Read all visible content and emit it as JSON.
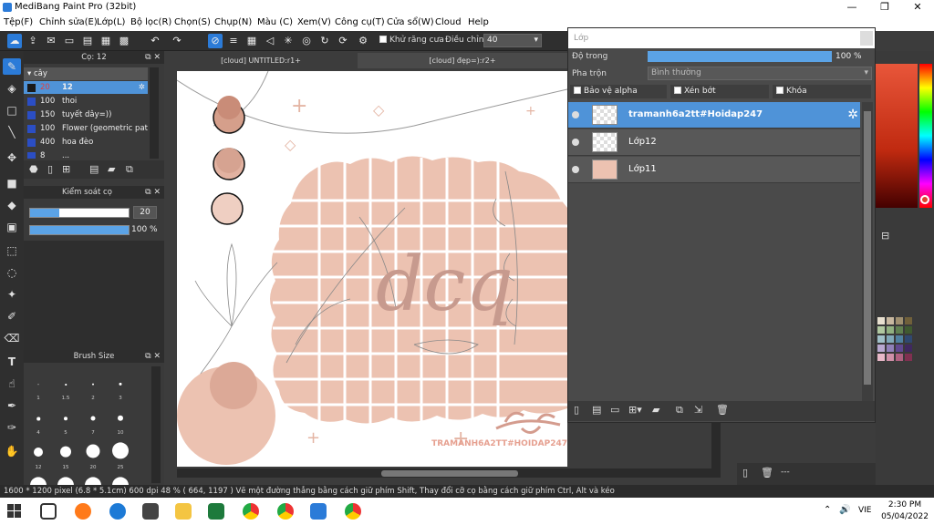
{
  "window": {
    "title": "MediBang Paint Pro (32bit)",
    "minimize": "—",
    "restore": "❐",
    "close": "✕"
  },
  "menu": [
    "Tệp(F)",
    "Chỉnh sửa(E)",
    "Lớp(L)",
    "Bộ lọc(R)",
    "Chọn(S)",
    "Chụp(N)",
    "Màu (C)",
    "Xem(V)",
    "Công cụ(T)",
    "Cửa sổ(W)",
    "Cloud",
    "Help"
  ],
  "toolbar": {
    "antialias_label": "Khử răng cưa",
    "adjust_label": "Điều chỉnh",
    "adjust_value": "40"
  },
  "brush_panel": {
    "title": "Cọ: 12",
    "category": "cây",
    "items": [
      {
        "size": "20",
        "name": "12"
      },
      {
        "size": "100",
        "name": "thoi"
      },
      {
        "size": "150",
        "name": "tuyết dây=))"
      },
      {
        "size": "100",
        "name": "Flower (geometric patt"
      },
      {
        "size": "400",
        "name": "hoa đèo"
      },
      {
        "size": "8",
        "name": "..."
      }
    ]
  },
  "brush_control": {
    "title": "Kiểm soát cọ",
    "size_value": "20",
    "opacity_value": "100 %",
    "size_fill": 0.3,
    "opacity_fill": 1.0
  },
  "brush_size": {
    "title": "Brush Size",
    "labels": [
      "1",
      "1.5",
      "2",
      "3",
      "4",
      "5",
      "7",
      "10",
      "12",
      "15",
      "20",
      "25"
    ]
  },
  "doc_tabs": [
    "[cloud] UNTITLED:r1+",
    "[cloud] đẹp=):r2+"
  ],
  "layer_panel": {
    "title": "Lớp",
    "opacity_label": "Độ trong",
    "opacity_value": "100 %",
    "blend_label": "Pha trộn",
    "blend_value": "Bình thường",
    "protect_alpha": "Bảo vệ alpha",
    "clipping": "Xén bớt",
    "lock": "Khóa",
    "layers": [
      "tramanh6a2tt#Hoidap247",
      "Lớp12",
      "Lớp11"
    ]
  },
  "canvas": {
    "watermark": "TRAMANH6A2TT#HOIDAP247",
    "lettering": "dcq"
  },
  "right_panel": {
    "dash": "---"
  },
  "palette_colors": [
    "#e8e0d0",
    "#c8b8a0",
    "#a09070",
    "#70603a",
    "#b0c8a0",
    "#90b080",
    "#608050",
    "#405a30",
    "#a0c0c8",
    "#80a8b8",
    "#5080a0",
    "#304870",
    "#b8a8d0",
    "#9080b8",
    "#604890",
    "#402860",
    "#e8b8c8",
    "#d090a8",
    "#b06080",
    "#803050"
  ],
  "status": {
    "text": "1600 * 1200 pixel  (6.8 * 5.1cm)  600 dpi  48 %  ( 664, 1197 )  Vẽ một đường thẳng bằng cách giữ phím Shift, Thay đổi cỡ cọ bằng cách giữ phím Ctrl, Alt và kéo"
  },
  "taskbar": {
    "time": "2:30 PM",
    "date": "05/04/2022",
    "lang": "VIE"
  }
}
